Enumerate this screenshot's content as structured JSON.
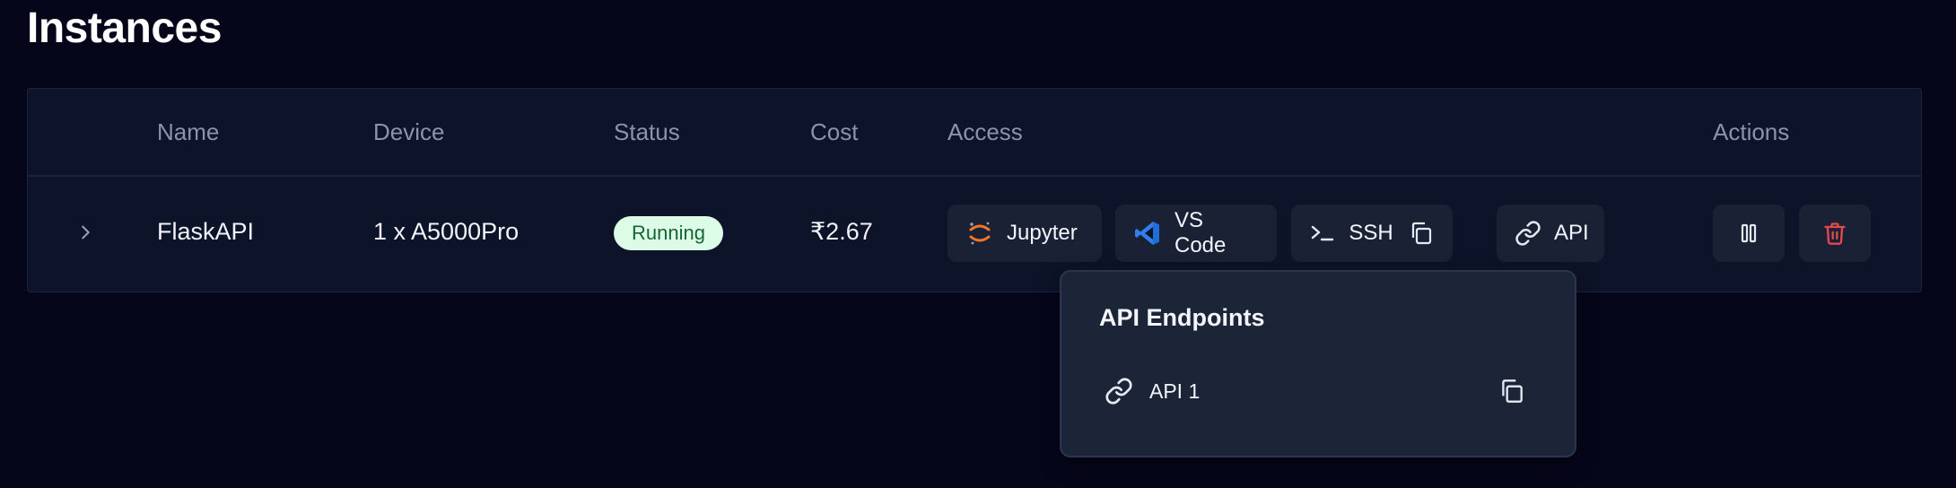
{
  "page": {
    "title": "Instances"
  },
  "table": {
    "headers": {
      "name": "Name",
      "device": "Device",
      "status": "Status",
      "cost": "Cost",
      "access": "Access",
      "actions": "Actions"
    },
    "rows": [
      {
        "name": "FlaskAPI",
        "device": "1 x A5000Pro",
        "status": "Running",
        "cost": "₹2.67",
        "access": {
          "jupyter": "Jupyter",
          "vscode": "VS Code",
          "ssh": "SSH",
          "api": "API"
        }
      }
    ]
  },
  "popover": {
    "title": "API Endpoints",
    "endpoints": [
      {
        "label": "API 1"
      }
    ]
  },
  "colors": {
    "background": "#05061a",
    "table_bg": "#0d1328",
    "button_bg": "#1a2135",
    "status_bg": "#dcfce7",
    "status_text": "#166534",
    "jupyter_orange": "#f37626",
    "vscode_blue": "#2f80ed",
    "delete_red": "#e5484d"
  },
  "icons": {
    "expand": "chevron-right-icon",
    "jupyter": "jupyter-icon",
    "vscode": "vscode-icon",
    "ssh": "terminal-icon",
    "copy": "copy-icon",
    "api": "link-icon",
    "pause": "pause-icon",
    "delete": "trash-icon"
  }
}
